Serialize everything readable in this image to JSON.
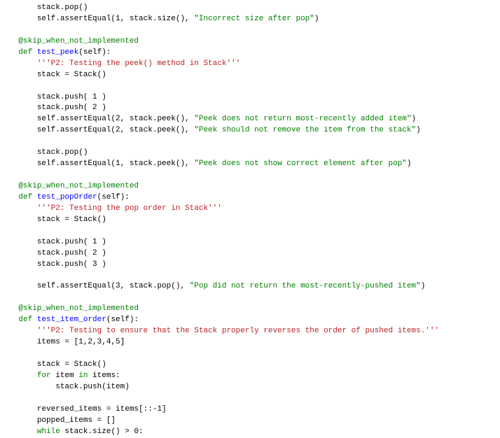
{
  "indent2": "        ",
  "indent1": "    ",
  "lines": {
    "l01a": "stack.pop()",
    "l02a": "self.assertEqual(1, stack.size(), ",
    "l02s": "\"Incorrect size after pop\"",
    "l02b": ")",
    "dec": "@skip_when_not_implemented",
    "def": "def",
    "fn_peek": "test_peek",
    "sig": "(self):",
    "doc_peek": "'''P2: Testing the peek() method in Stack'''",
    "stk_new": "stack = Stack()",
    "push1": "stack.push( 1 )",
    "push2": "stack.push( 2 )",
    "push3": "stack.push( 3 )",
    "ae_pre": "self.assertEqual(2, stack.peek(), ",
    "s_peek1": "\"Peek does not return most-recently added item\"",
    "s_peek2": "\"Peek should not remove the item from the stack\"",
    "close": ")",
    "pop": "stack.pop()",
    "ae_peek3_pre": "self.assertEqual(1, stack.peek(), ",
    "s_peek3": "\"Peek does not show correct element after pop\"",
    "fn_popOrder": "test_popOrder",
    "doc_popOrder": "'''P2: Testing the pop order in Stack'''",
    "ae_pop_pre": "self.assertEqual(3, stack.pop(), ",
    "s_pop": "\"Pop did not return the most-recently-pushed item\"",
    "fn_itemOrder": "test_item_order",
    "doc_itemOrder": "'''P2: Testing to ensure that the Stack properly reverses the order of pushed items.'''",
    "items_assign": "items = [1,2,3,4,5]",
    "for_kw": "for",
    "for_mid": " item ",
    "in_kw": "in",
    "for_tail": " items:",
    "for_body": "stack.push(item)",
    "rev": "reversed_items = items[::-1]",
    "popped": "popped_items = []",
    "while_kw": "while",
    "while_tail": " stack.size() > 0:"
  },
  "chart_data": null
}
